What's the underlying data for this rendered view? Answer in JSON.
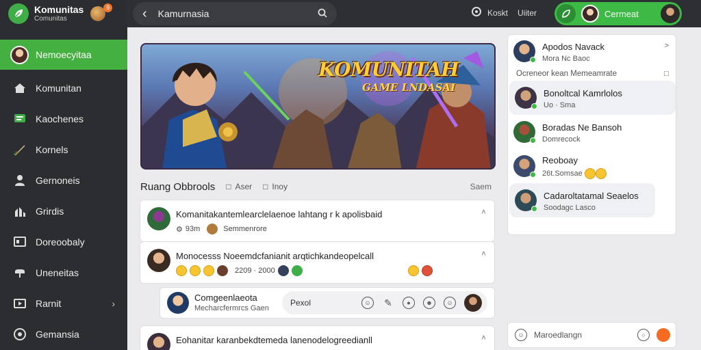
{
  "brand": {
    "title": "Komunitas",
    "subtitle": "Comunitas",
    "badge": "9"
  },
  "sidebar": {
    "active": {
      "label": "Nemoecyitaa"
    },
    "items": [
      {
        "label": "Komunitan",
        "icon": "home-icon"
      },
      {
        "label": "Kaochenes",
        "icon": "chat-icon"
      },
      {
        "label": "Kornels",
        "icon": "sword-icon"
      },
      {
        "label": "Gernoneis",
        "icon": "person-icon"
      },
      {
        "label": "Grirdis",
        "icon": "group-icon"
      },
      {
        "label": "Doreoobaly",
        "icon": "dashboard-icon"
      },
      {
        "label": "Uneneitas",
        "icon": "controller-icon"
      },
      {
        "label": "Rarnit",
        "icon": "media-icon"
      },
      {
        "label": "Gemansia",
        "icon": "settings-icon"
      }
    ]
  },
  "topbar": {
    "search_text": "Kamurnasia",
    "mid_label1": "Koskt",
    "mid_label2": "Uiiter",
    "profile_label": "Cermeat"
  },
  "banner": {
    "title": "KOMUNITAH",
    "subtitle": "GAME LNDASAI"
  },
  "room": {
    "title": "Ruang Obbrools",
    "tab1": "Aser",
    "tab2": "Inoy",
    "right": "Saem"
  },
  "posts": [
    {
      "text": "Komanitakantemlearclelaenoe lahtang r k apolisbaid",
      "meta": "93m",
      "meta2": "Semmenrore"
    },
    {
      "text": "Monocesss Noeemdcfanianit arqtichkandeopelcall",
      "meta": "2209 · 2000"
    },
    {
      "text": "Eohanitar karanbekdtemeda lanenodelogreedianll",
      "meta": ""
    }
  ],
  "reply": {
    "title": "Comgeenlaeota",
    "sub": "Mecharcfermrcs Gaen",
    "placeholder": "Pexol"
  },
  "rpanel": {
    "head": {
      "name": "Apodos Navack",
      "sub": "Mora Nc Baoc"
    },
    "caption": "Ocreneor kean Memeamrate",
    "items": [
      {
        "name": "Bonoltcal Kamrlolos",
        "sub": "Uo · Sma"
      },
      {
        "name": "Boradas Ne Bansoh",
        "sub": "Domrecock"
      },
      {
        "name": "Reoboay",
        "sub": "26t.Somsae"
      },
      {
        "name": "Cadaroltatamal Seaelos",
        "sub": "Soodagc Lasco"
      }
    ]
  },
  "compose": {
    "placeholder": "Maroedlangn"
  }
}
